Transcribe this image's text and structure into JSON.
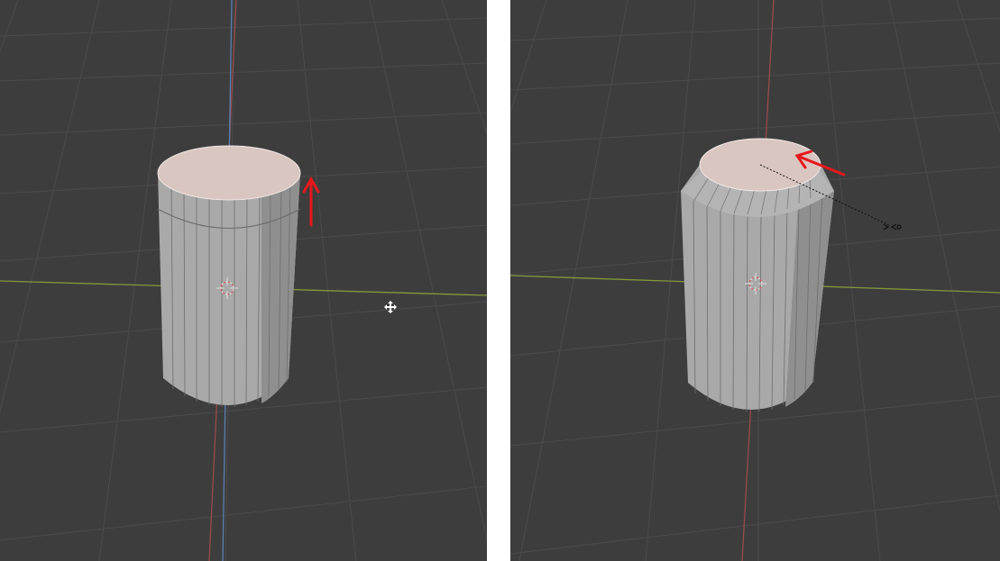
{
  "panels": [
    {
      "id": "left",
      "step": "extrude-top-face",
      "arrow_direction": "up",
      "object": "cylinder",
      "selected_face": "top"
    },
    {
      "id": "right",
      "step": "scale-top-face-inward",
      "arrow_direction": "inward",
      "object": "cylinder",
      "selected_face": "top"
    }
  ],
  "colors": {
    "viewport_bg": "#3d3d3d",
    "grid_line": "#4a4a4a",
    "x_axis": "#9a4a4a",
    "y_axis": "#7f9a3a",
    "z_axis": "#5b7fb3",
    "mesh_side": "#a9a9a9",
    "mesh_top_selected": "#d9c6c1",
    "annotation_arrow": "#e8171b",
    "divider": "#ffffff"
  },
  "icons": [
    "3d-cursor-icon",
    "move-gizmo-icon",
    "scale-pivot-icon"
  ]
}
